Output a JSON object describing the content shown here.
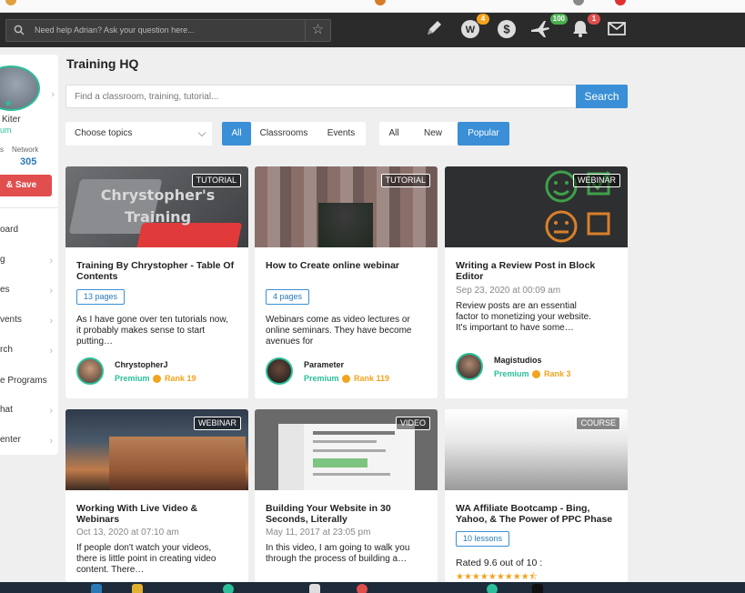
{
  "topbar": {
    "help_placeholder": "Need help Adrian? Ask your question here...",
    "badges": {
      "ranking": "4",
      "wings": "100",
      "notifications": "1"
    }
  },
  "sidebar": {
    "name": "Kiter",
    "level": "um",
    "stat_left": "s",
    "stat_right": "Network",
    "network_count": "305",
    "button_label": "& Save",
    "nav": [
      "oard",
      "g",
      "es",
      "vents",
      "rch",
      "e Programs",
      "hat",
      "enter"
    ]
  },
  "main": {
    "title": "Training HQ",
    "search_placeholder": "Find a classroom, training, tutorial...",
    "search_button": "Search",
    "topics_label": "Choose topics",
    "type_filter": [
      "All",
      "Classrooms",
      "Events"
    ],
    "sort_filter": [
      "All",
      "New",
      "Popular"
    ]
  },
  "cards": [
    {
      "tag": "TUTORIAL",
      "thumb_text": "Chrystopher's Training",
      "title": "Training By Chrystopher - Table Of Contents",
      "pill": "13 pages",
      "excerpt": "As I have gone over ten tutorials now, it probably makes sense to start putting…",
      "author": "ChrystopherJ",
      "premium": "Premium",
      "rank": "Rank 19"
    },
    {
      "tag": "TUTORIAL",
      "title": "How to Create online webinar",
      "pill": "4 pages",
      "excerpt": "Webinars come as video lectures or online seminars. They have become avenues for",
      "author": "Parameter",
      "premium": "Premium",
      "rank": "Rank 119"
    },
    {
      "tag": "WEBINAR",
      "title": "Writing a Review Post in Block Editor",
      "date": "Sep 23, 2020 at 00:09 am",
      "excerpt": "Review posts are an essential factor to monetizing your website. It's important to have some…",
      "author": "Magistudios",
      "premium": "Premium",
      "rank": "Rank 3"
    },
    {
      "tag": "WEBINAR",
      "title": "Working With Live Video & Webinars",
      "date": "Oct 13, 2020 at 07:10 am",
      "excerpt": "If people don't watch your videos, there is little point in creating video content. There…"
    },
    {
      "tag": "VIDEO",
      "title": "Building Your Website in 30 Seconds, Literally",
      "date": "May 11, 2017 at 23:05 pm",
      "excerpt": "In this video, I am going to walk you through the process of building a…"
    },
    {
      "tag": "COURSE",
      "title": "WA Affiliate Bootcamp - Bing, Yahoo, & The Power of PPC Phase",
      "pill": "10 lessons",
      "rating": "Rated 9.6 out of 10 :",
      "stars": "★★★★★★★★★⯪"
    }
  ]
}
